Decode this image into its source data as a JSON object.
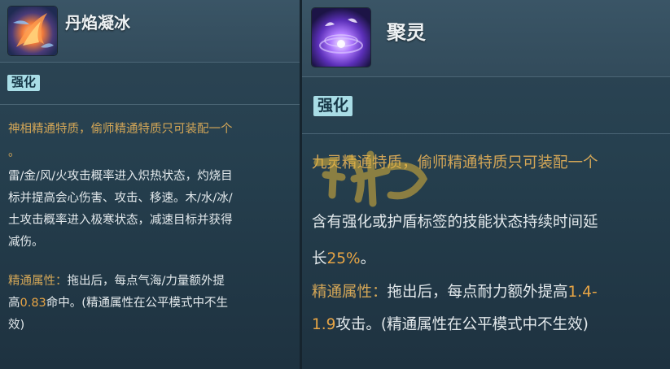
{
  "left": {
    "skill_name": "丹焰凝冰",
    "icon": "flame-frost-skill-icon",
    "tag": "强化",
    "lines": [
      "神相精通特质，偷师精通特质只可装配一个",
      "。",
      "雷/金/风/火攻击概率进入炽热状态，灼烧目",
      "标并提高会心伤害、攻击、移速。木/水/冰/",
      "土攻击概率进入极寒状态，减速目标并获得",
      "减伤。",
      "精通属性：",
      "拖出后，每点气海/力量额外提",
      "高",
      "0.83",
      "命中。(精通属性在公平模式中不生",
      "效)"
    ]
  },
  "right": {
    "skill_name": "聚灵",
    "icon": "purple-vortex-skill-icon",
    "tag": "强化",
    "lines": [
      "九灵精通特质，偷师精通特质只可装配一个",
      "含有强化或护盾标签的技能状态持续时间延",
      "长",
      "25%",
      "。",
      "精通属性：",
      "拖出后，每点耐力额外提高",
      "1.4-",
      "1.9",
      "攻击。(精通属性在公平模式中不生效)"
    ]
  },
  "colors": {
    "gold": "#d3a657",
    "orange": "#e8a545",
    "tag_bg": "#a9dde6"
  }
}
